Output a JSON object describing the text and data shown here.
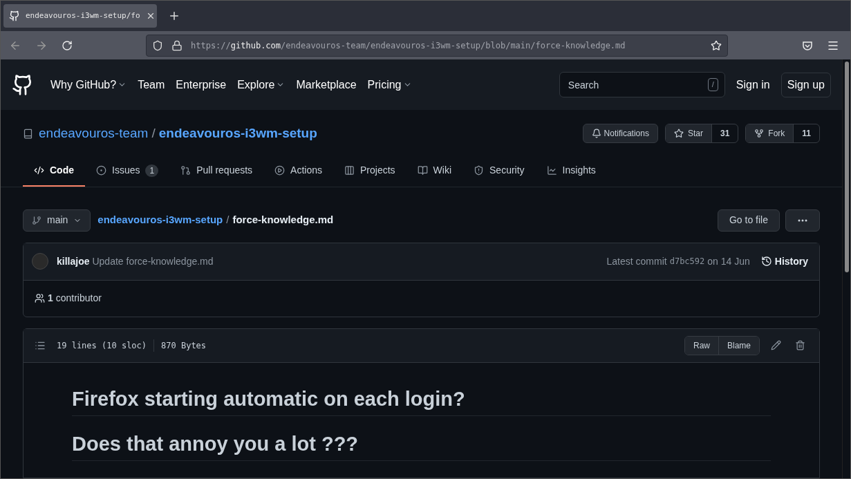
{
  "browser": {
    "tab": {
      "title": "endeavouros-i3wm-setup/fo",
      "selected": true
    },
    "url": {
      "scheme": "https://",
      "host": "github.com",
      "path": "/endeavouros-team/endeavouros-i3wm-setup/blob/main/force-knowledge.md"
    }
  },
  "header": {
    "nav": [
      {
        "label": "Why GitHub?",
        "dropdown": true
      },
      {
        "label": "Team",
        "dropdown": false
      },
      {
        "label": "Enterprise",
        "dropdown": false
      },
      {
        "label": "Explore",
        "dropdown": true
      },
      {
        "label": "Marketplace",
        "dropdown": false
      },
      {
        "label": "Pricing",
        "dropdown": true
      }
    ],
    "search": {
      "placeholder": "Search",
      "key": "/"
    },
    "sign_in": "Sign in",
    "sign_up": "Sign up"
  },
  "repo": {
    "owner": "endeavouros-team",
    "separator": "/",
    "name": "endeavouros-i3wm-setup",
    "notifications": "Notifications",
    "star": {
      "label": "Star",
      "count": "31"
    },
    "fork": {
      "label": "Fork",
      "count": "11"
    }
  },
  "tabs": [
    {
      "kind": "code",
      "label": "Code",
      "selected": true
    },
    {
      "kind": "issues",
      "label": "Issues",
      "count": "1",
      "selected": false
    },
    {
      "kind": "pulls",
      "label": "Pull requests",
      "selected": false
    },
    {
      "kind": "actions",
      "label": "Actions",
      "selected": false
    },
    {
      "kind": "projects",
      "label": "Projects",
      "selected": false
    },
    {
      "kind": "wiki",
      "label": "Wiki",
      "selected": false
    },
    {
      "kind": "security",
      "label": "Security",
      "selected": false
    },
    {
      "kind": "insights",
      "label": "Insights",
      "selected": false
    }
  ],
  "file_nav": {
    "branch": "main",
    "repo_link": "endeavouros-i3wm-setup",
    "separator": "/",
    "file": "force-knowledge.md",
    "go_to_file": "Go to file"
  },
  "commit": {
    "author": "killajoe",
    "message": "Update force-knowledge.md",
    "latest": "Latest commit",
    "sha": "d7bc592",
    "date": "on 14 Jun",
    "history": "History",
    "contributors": "**1** contributor"
  },
  "file": {
    "lines": "19 lines (10 sloc)",
    "size": "870 Bytes",
    "raw": "Raw",
    "blame": "Blame"
  },
  "content": [
    "Firefox starting automatic on each login?",
    "Does that annoy you a lot ???"
  ]
}
